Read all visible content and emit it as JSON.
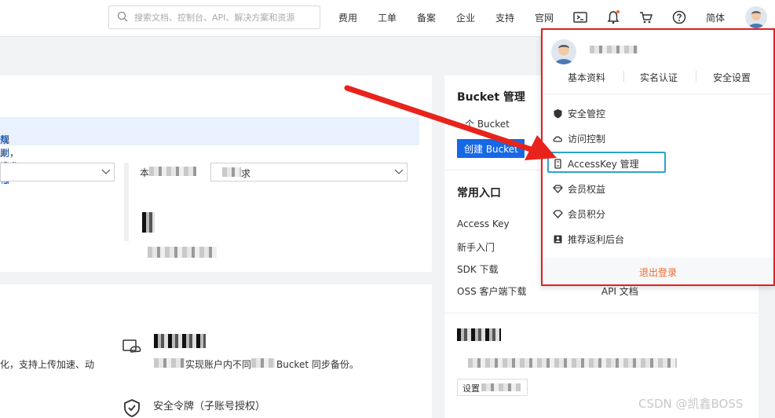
{
  "header": {
    "search_placeholder": "搜索文档、控制台、API、解决方案和资源",
    "nav": [
      "费用",
      "工单",
      "备案",
      "企业",
      "支持",
      "官网"
    ],
    "lang": "简体"
  },
  "main": {
    "info_text": "规则，请参考",
    "info_link": "帮助文档",
    "filter_label": "本",
    "filter_value": "求"
  },
  "features": {
    "item1_desc_left": "化，支持上传加速、动",
    "item1_desc": "实现账户内不同",
    "item1_desc_tail": "Bucket 同步备份。",
    "item2_title": "安全令牌（子账号授权）"
  },
  "right_panel": {
    "bucket_title": "Bucket 管理",
    "bucket_count": "个 Bucket",
    "create_button": "创建 Bucket",
    "common_title": "常用入口",
    "links": [
      "Access Key",
      "新手入门",
      "SDK 下载",
      "OSS 客户端下载"
    ],
    "api_doc": "API 文档",
    "setting_label": "设置"
  },
  "dropdown": {
    "tabs": [
      "基本资料",
      "实名认证",
      "安全设置"
    ],
    "items": [
      "安全管控",
      "访问控制",
      "AccessKey 管理",
      "会员权益",
      "会员积分",
      "推荐返利后台"
    ],
    "logout": "退出登录"
  },
  "watermark": "CSDN @凯鑫BOSS",
  "colors": {
    "primary": "#1768e4",
    "highlight_box": "#e02020",
    "arrow": "#e8231c",
    "focus_box": "#2da2cc",
    "logout": "#ee6a2c"
  }
}
